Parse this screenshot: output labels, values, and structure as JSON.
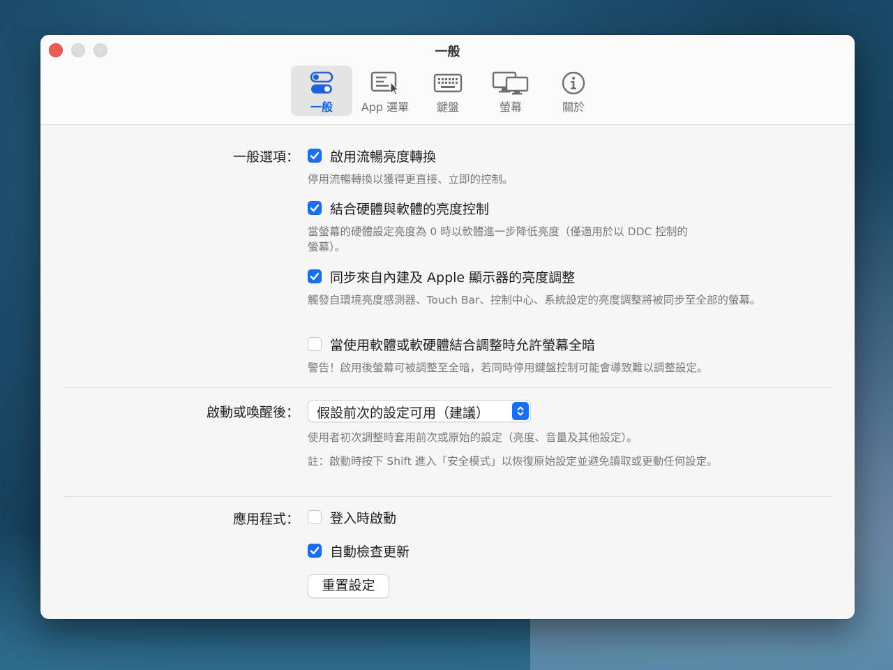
{
  "window": {
    "title": "一般"
  },
  "toolbar": {
    "tabs": [
      {
        "label": "一般",
        "icon": "toggles-icon",
        "selected": true
      },
      {
        "label": "App 選單",
        "icon": "menu-pointer-icon",
        "selected": false
      },
      {
        "label": "鍵盤",
        "icon": "keyboard-icon",
        "selected": false
      },
      {
        "label": "螢幕",
        "icon": "displays-icon",
        "selected": false
      },
      {
        "label": "關於",
        "icon": "info-icon",
        "selected": false
      }
    ]
  },
  "general_options": {
    "label": "一般選項：",
    "smooth_brightness": {
      "label": "啟用流暢亮度轉換",
      "checked": true,
      "description": "停用流暢轉換以獲得更直接、立即的控制。"
    },
    "combined_control": {
      "label": "結合硬體與軟體的亮度控制",
      "checked": true,
      "description_line1": "當螢幕的硬體設定亮度為 0 時以軟體進一步降低亮度（僅適用於以 DDC 控制的",
      "description_line2": "螢幕）。"
    },
    "sync_apple": {
      "label": "同步來自內建及 Apple 顯示器的亮度調整",
      "checked": true,
      "description": "觸發自環境亮度感測器、Touch Bar、控制中心、系統設定的亮度調整將被同步至全部的螢幕。"
    },
    "allow_dark": {
      "label": "當使用軟體或軟硬體結合調整時允許螢幕全暗",
      "checked": false,
      "description": "警告！啟用後螢幕可被調整至全暗，若同時停用鍵盤控制可能會導致難以調整設定。"
    }
  },
  "startup": {
    "label": "啟動或喚醒後：",
    "selected_option": "假設前次的設定可用（建議）",
    "description": "使用者初次調整時套用前次或原始的設定（亮度、音量及其他設定）。",
    "note": "註：啟動時按下 Shift 進入「安全模式」以恢復原始設定並避免讀取或更動任何設定。"
  },
  "application": {
    "label": "應用程式：",
    "launch_at_login": {
      "label": "登入時啟動",
      "checked": false
    },
    "auto_update": {
      "label": "自動檢查更新",
      "checked": true
    },
    "reset_button": "重置設定"
  },
  "colors": {
    "accent": "#1a6ff0",
    "close": "#ee5b56"
  }
}
